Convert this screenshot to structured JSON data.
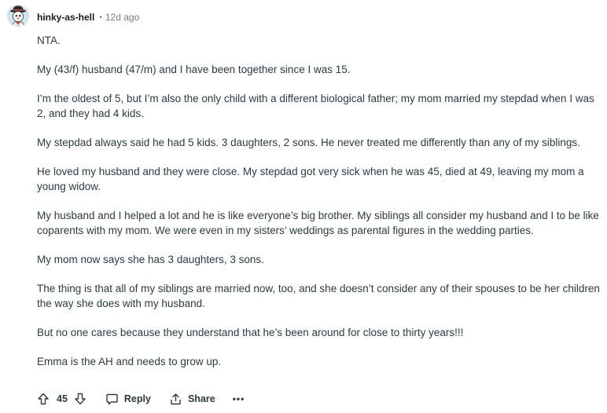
{
  "comment": {
    "username": "hinky-as-hell",
    "separator": "•",
    "timestamp": "12d ago",
    "paragraphs": [
      "NTA.",
      "My (43/f) husband (47/m) and I have been together since I was 15.",
      "I’m the oldest of 5, but I’m also the only child with a different biological father; my mom married my stepdad when I was 2, and they had 4 kids.",
      "My stepdad always said he had 5 kids. 3 daughters, 2 sons. He never treated me differently than any of my siblings.",
      "He loved my husband and they were close. My stepdad got very sick when he was 45, died at 49, leaving my mom a young widow.",
      "My husband and I helped a lot and he is like everyone’s big brother. My siblings all consider my husband and I to be like coparents with my mom. We were even in my sisters’ weddings as parental figures in the wedding parties.",
      "My mom now says she has 3 daughters, 3 sons.",
      "The thing is that all of my siblings are married now, too, and she doesn’t consider any of their spouses to be her children the way she does with my husband.",
      "But no one cares because they understand that he’s been around for close to thirty years!!!",
      "Emma is the AH and needs to grow up."
    ]
  },
  "actions": {
    "score": "45",
    "reply_label": "Reply",
    "share_label": "Share",
    "more_label": "•••"
  },
  "icons": {
    "avatar": "avatar-icon",
    "upvote": "upvote-arrow-icon",
    "downvote": "downvote-arrow-icon",
    "reply": "speech-bubble-icon",
    "share": "share-icon",
    "more": "more-options-icon"
  },
  "colors": {
    "text": "#2a3c42",
    "meta": "#7c7c7c",
    "avatar_bg": "#cfe4ef"
  }
}
